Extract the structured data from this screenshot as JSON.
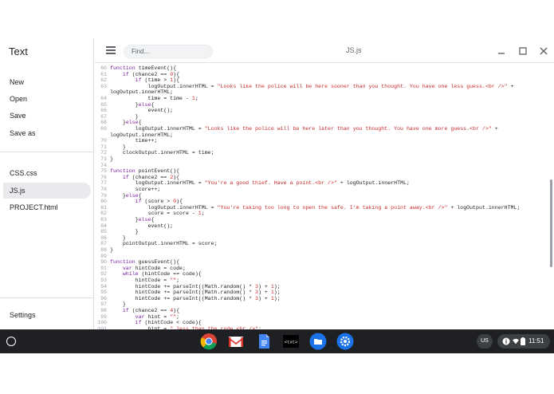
{
  "app": {
    "title": "Text",
    "menu": [
      "New",
      "Open",
      "Save",
      "Save as"
    ],
    "files": [
      "CSS.css",
      "JS.js",
      "PROJECT.html"
    ],
    "active_file": "JS.js",
    "settings_label": "Settings"
  },
  "header": {
    "find_placeholder": "Find...",
    "file_title": "JS.js"
  },
  "editor": {
    "lines": [
      {
        "n": "60",
        "t": "function timeEvent(){"
      },
      {
        "n": "61",
        "t": "    if (chance2 == 0){"
      },
      {
        "n": "62",
        "t": "        if (time > 1){"
      },
      {
        "n": "63",
        "t": "            logOutput.innerHTML = \"Looks like the police will be here sooner than you thought. You have one less guess.<br />\" +"
      },
      {
        "n": "",
        "t": "logOutput.innerHTML;"
      },
      {
        "n": "64",
        "t": "            time = time - 1;"
      },
      {
        "n": "65",
        "t": "        }else{"
      },
      {
        "n": "66",
        "t": "            event();"
      },
      {
        "n": "67",
        "t": "        }"
      },
      {
        "n": "68",
        "t": "    }else{"
      },
      {
        "n": "69",
        "t": "        logOutput.innerHTML = \"Looks like the police will be here later than you thought. You have one more guess.<br />\" +"
      },
      {
        "n": "",
        "t": "logOutput.innerHTML;"
      },
      {
        "n": "70",
        "t": "        time++;"
      },
      {
        "n": "71",
        "t": "    }"
      },
      {
        "n": "72",
        "t": "    clockOutput.innerHTML = time;"
      },
      {
        "n": "73",
        "t": "}"
      },
      {
        "n": "74",
        "t": ""
      },
      {
        "n": "75",
        "t": "function pointEvent(){"
      },
      {
        "n": "76",
        "t": "    if (chance2 == 2){"
      },
      {
        "n": "77",
        "t": "        logOutput.innerHTML = \"You're a good thief. Have a point.<br />\" + logOutput.innerHTML;"
      },
      {
        "n": "78",
        "t": "        score++;"
      },
      {
        "n": "79",
        "t": "    }else{"
      },
      {
        "n": "80",
        "t": "        if (score > 0){"
      },
      {
        "n": "81",
        "t": "            logOutput.innerHTML = \"You're taking too long to open the safe. I'm taking a point away.<br />\" + logOutput.innerHTML;"
      },
      {
        "n": "82",
        "t": "            score = score - 1;"
      },
      {
        "n": "83",
        "t": "        }else{"
      },
      {
        "n": "84",
        "t": "            event();"
      },
      {
        "n": "85",
        "t": "        }"
      },
      {
        "n": "86",
        "t": "    }"
      },
      {
        "n": "87",
        "t": "    pointOutput.innerHTML = score;"
      },
      {
        "n": "88",
        "t": "}"
      },
      {
        "n": "89",
        "t": ""
      },
      {
        "n": "90",
        "t": "function guessEvent(){"
      },
      {
        "n": "91",
        "t": "    var hintCode = code;"
      },
      {
        "n": "92",
        "t": "    while (hintCode == code){"
      },
      {
        "n": "93",
        "t": "        hintCode = \"\";"
      },
      {
        "n": "94",
        "t": "        hintCode += parseInt((Math.random() * 3) + 1);"
      },
      {
        "n": "95",
        "t": "        hintCode += parseInt((Math.random() * 3) + 1);"
      },
      {
        "n": "96",
        "t": "        hintCode += parseInt((Math.random() * 3) + 1);"
      },
      {
        "n": "97",
        "t": "    }"
      },
      {
        "n": "98",
        "t": "    if (chance2 == 4){"
      },
      {
        "n": "99",
        "t": "        var hint = \"\";"
      },
      {
        "n": "100",
        "t": "        if (hintCode < code){"
      },
      {
        "n": "101",
        "t": "            hint = \" less than the code.<br />\";"
      }
    ]
  },
  "shelf": {
    "ime_label": "US",
    "time": "11:51",
    "apps": [
      "chrome-icon",
      "gmail-icon",
      "docs-icon",
      "text-app-icon",
      "files-icon",
      "settings-icon"
    ]
  }
}
